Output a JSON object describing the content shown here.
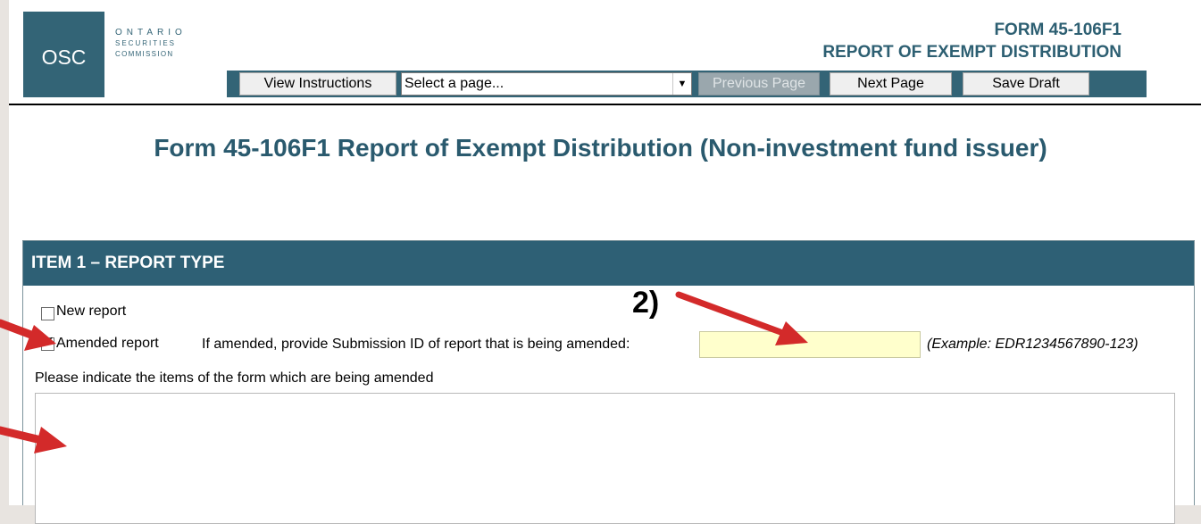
{
  "logo": {
    "abbr": "OSC",
    "line1": "ONTARIO",
    "line2": "SECURITIES",
    "line3": "COMMISSION"
  },
  "header": {
    "form_number": "FORM 45-106F1",
    "form_name": "REPORT OF EXEMPT DISTRIBUTION"
  },
  "toolbar": {
    "view_instructions": "View Instructions",
    "page_select_value": "Select a page...",
    "previous_page": "Previous Page",
    "next_page": "Next Page",
    "save_draft": "Save Draft"
  },
  "page_title": "Form 45-106F1 Report of Exempt Distribution (Non-investment fund issuer)",
  "item1": {
    "header": "ITEM 1 – REPORT TYPE",
    "new_report_label": "New report",
    "new_report_checked": false,
    "amended_report_label": "Amended report",
    "amended_report_checked": true,
    "submission_id_prompt": "If amended, provide Submission ID of report that is being amended:",
    "submission_id_value": "",
    "submission_id_example": "(Example: EDR1234567890-123)",
    "amended_items_prompt": "Please indicate the items of the form which are being amended",
    "amended_items_value": ""
  },
  "annotations": {
    "marker_2": "2)"
  },
  "colors": {
    "brand": "#336476",
    "header_bar": "#2e6075",
    "title_text": "#2a5a6e",
    "input_highlight": "#ffffcc",
    "arrow": "#d32a2a"
  },
  "icons": {
    "select_arrow": "caret-down-icon",
    "check": "checkmark-icon",
    "annotation_arrow": "red-arrow-icon"
  }
}
